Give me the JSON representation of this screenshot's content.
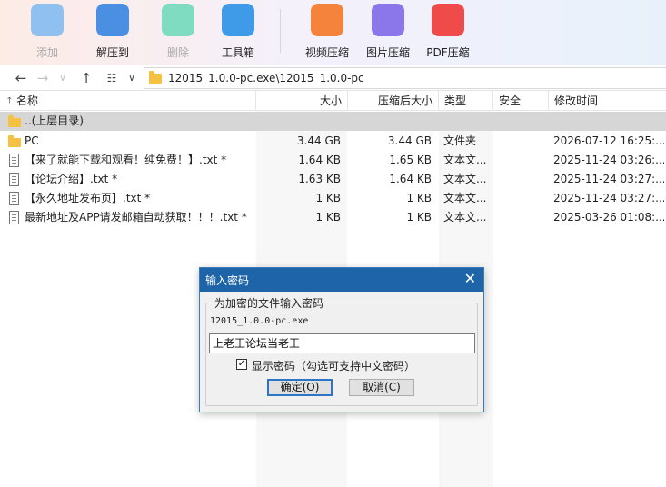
{
  "toolbar": {
    "buttons": [
      {
        "label": "添加",
        "icon": "add-archive-icon",
        "color": "#5fa7ea",
        "disabled": true
      },
      {
        "label": "解压到",
        "icon": "extract-icon",
        "color": "#4b8fe2",
        "disabled": false
      },
      {
        "label": "删除",
        "icon": "recycle-bin-icon",
        "color": "#3cc7a0",
        "disabled": true
      },
      {
        "label": "工具箱",
        "icon": "toolbox-icon",
        "color": "#3f9ae8",
        "disabled": false
      },
      {
        "label": "视频压缩",
        "icon": "video-compress-icon",
        "color": "#f5833b",
        "disabled": false
      },
      {
        "label": "图片压缩",
        "icon": "image-compress-icon",
        "color": "#8b76ea",
        "disabled": false
      },
      {
        "label": "PDF压缩",
        "icon": "pdf-compress-icon",
        "color": "#ef4b4b",
        "disabled": false
      }
    ]
  },
  "address": {
    "path": "12015_1.0.0-pc.exe\\12015_1.0.0-pc"
  },
  "columns": {
    "name": "名称",
    "size": "大小",
    "packed": "压缩后大小",
    "type": "类型",
    "security": "安全",
    "modified": "修改时间"
  },
  "files": [
    {
      "name": "..(上层目录)",
      "size": "",
      "packed": "",
      "type": "",
      "modified": "",
      "icon": "folder-icon",
      "selected": true
    },
    {
      "name": "PC",
      "size": "3.44 GB",
      "packed": "3.44 GB",
      "type": "文件夹",
      "modified": "2026-07-12 16:25:...",
      "icon": "folder-icon",
      "selected": false
    },
    {
      "name": "【来了就能下载和观看！纯免费！】.txt *",
      "size": "1.64 KB",
      "packed": "1.65 KB",
      "type": "文本文...",
      "modified": "2025-11-24 03:26:...",
      "icon": "text-file-icon",
      "selected": false
    },
    {
      "name": "【论坛介绍】.txt *",
      "size": "1.63 KB",
      "packed": "1.64 KB",
      "type": "文本文...",
      "modified": "2025-11-24 03:27:...",
      "icon": "text-file-icon",
      "selected": false
    },
    {
      "name": "【永久地址发布页】.txt *",
      "size": "1 KB",
      "packed": "1 KB",
      "type": "文本文...",
      "modified": "2025-11-24 03:27:...",
      "icon": "text-file-icon",
      "selected": false
    },
    {
      "name": "最新地址及APP请发邮箱自动获取！！！.txt *",
      "size": "1 KB",
      "packed": "1 KB",
      "type": "文本文...",
      "modified": "2025-03-26 01:08:...",
      "icon": "text-file-icon",
      "selected": false
    }
  ],
  "dialog": {
    "title": "输入密码",
    "group_label": "为加密的文件输入密码",
    "filename": "12015_1.0.0-pc.exe",
    "password_value": "上老王论坛当老王",
    "show_password_checked": true,
    "show_password_label": "显示密码（勾选可支持中文密码）",
    "ok_label": "确定(O)",
    "cancel_label": "取消(C)"
  }
}
